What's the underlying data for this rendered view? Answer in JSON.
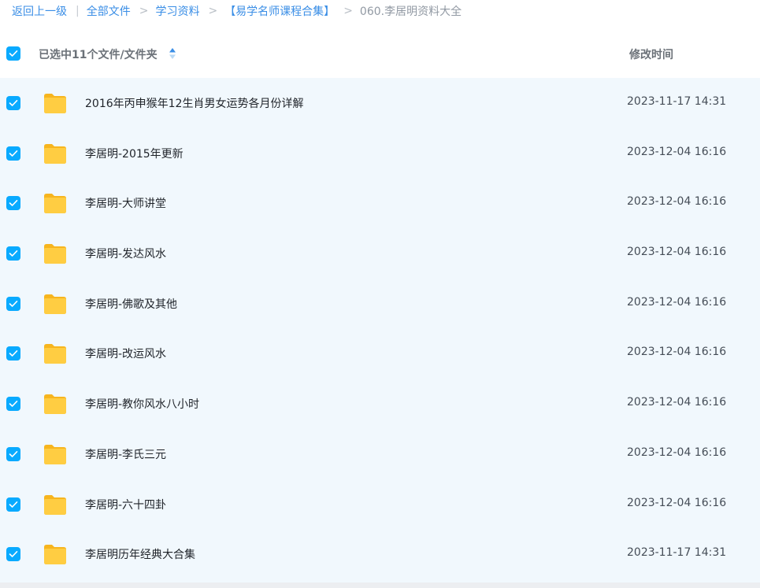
{
  "breadcrumb": {
    "back_label": "返回上一级",
    "divider": "|",
    "separator": ">",
    "items": [
      "全部文件",
      "学习资料",
      "【易学名师课程合集】"
    ],
    "current": "060.李居明资料大全"
  },
  "header": {
    "selection_label": "已选中11个文件/文件夹",
    "time_column_label": "修改时间"
  },
  "colors": {
    "accent": "#09aaff",
    "folder": "#ffc53d",
    "row_background": "#f1f8fd"
  },
  "files": [
    {
      "name": "2016年丙申猴年12生肖男女运势各月份详解",
      "modified": "2023-11-17 14:31",
      "icon": "folder-icon",
      "selected": true
    },
    {
      "name": "李居明-2015年更新",
      "modified": "2023-12-04 16:16",
      "icon": "folder-icon",
      "selected": true
    },
    {
      "name": "李居明-大师讲堂",
      "modified": "2023-12-04 16:16",
      "icon": "folder-icon",
      "selected": true
    },
    {
      "name": "李居明-发达风水",
      "modified": "2023-12-04 16:16",
      "icon": "folder-icon",
      "selected": true
    },
    {
      "name": "李居明-佛歌及其他",
      "modified": "2023-12-04 16:16",
      "icon": "folder-icon",
      "selected": true
    },
    {
      "name": "李居明-改运风水",
      "modified": "2023-12-04 16:16",
      "icon": "folder-icon",
      "selected": true
    },
    {
      "name": "李居明-教你风水八小时",
      "modified": "2023-12-04 16:16",
      "icon": "folder-icon",
      "selected": true
    },
    {
      "name": "李居明-李氏三元",
      "modified": "2023-12-04 16:16",
      "icon": "folder-icon",
      "selected": true
    },
    {
      "name": "李居明-六十四卦",
      "modified": "2023-12-04 16:16",
      "icon": "folder-icon",
      "selected": true
    },
    {
      "name": "李居明历年经典大合集",
      "modified": "2023-11-17 14:31",
      "icon": "folder-icon",
      "selected": true
    }
  ]
}
